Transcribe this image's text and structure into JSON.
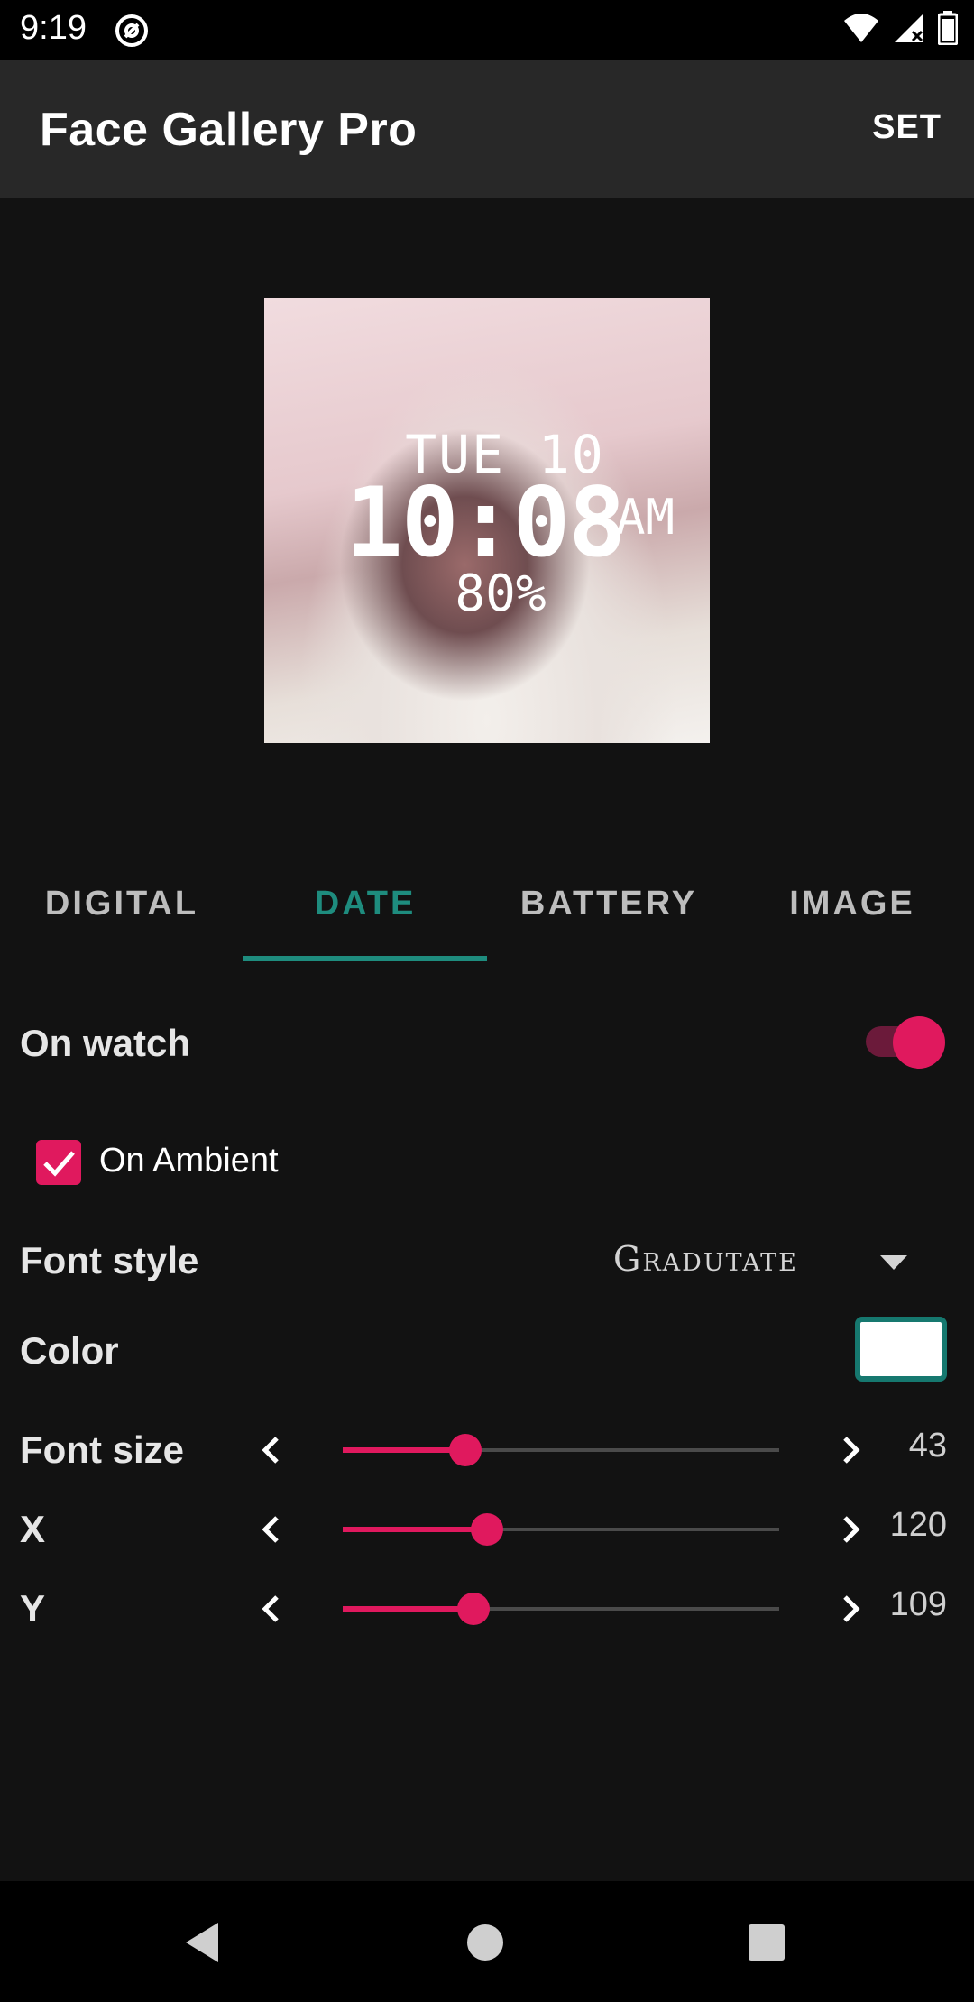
{
  "status_bar": {
    "time": "9:19"
  },
  "app_bar": {
    "title": "Face Gallery Pro",
    "set_label": "SET"
  },
  "preview": {
    "date": "TUE 10",
    "time": "10:08",
    "ampm": "AM",
    "battery": "80%"
  },
  "tabs": [
    {
      "label": "DIGITAL",
      "active": false
    },
    {
      "label": "DATE",
      "active": true
    },
    {
      "label": "BATTERY",
      "active": false
    },
    {
      "label": "IMAGE",
      "active": false
    }
  ],
  "settings": {
    "on_watch_label": "On watch",
    "on_watch_enabled": true,
    "on_ambient_label": "On Ambient",
    "on_ambient_checked": true,
    "font_style_label": "Font style",
    "font_style_value": "Gradutate",
    "color_label": "Color",
    "color_value": "#ffffff",
    "sliders": [
      {
        "label": "Font size",
        "value": "43",
        "fraction": 0.28
      },
      {
        "label": "X",
        "value": "120",
        "fraction": 0.33
      },
      {
        "label": "Y",
        "value": "109",
        "fraction": 0.3
      }
    ]
  },
  "colors": {
    "accent": "#e0195e",
    "tab_active": "#1e8c7e",
    "background": "#121212"
  }
}
